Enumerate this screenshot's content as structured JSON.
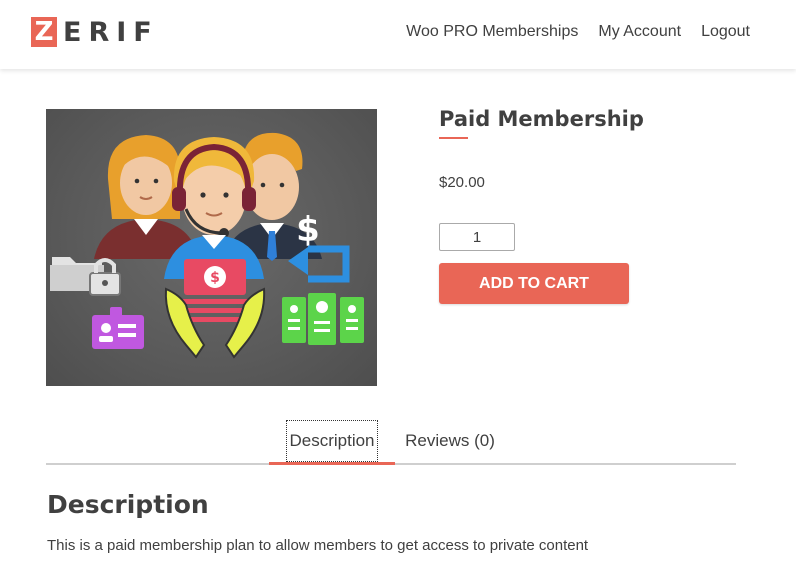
{
  "header": {
    "logo": {
      "letter": "Z",
      "rest": "ERIF"
    },
    "nav": [
      {
        "label": "Woo PRO Memberships"
      },
      {
        "label": "My Account"
      },
      {
        "label": "Logout"
      }
    ]
  },
  "product": {
    "title": "Paid Membership",
    "price": "$20.00",
    "quantity": "1",
    "add_to_cart_label": "ADD TO CART",
    "image_icon": "membership-illustration-icon"
  },
  "tabs": [
    {
      "label": "Description",
      "active": true
    },
    {
      "label": "Reviews (0)",
      "active": false
    }
  ],
  "description": {
    "heading": "Description",
    "text": "This is a paid membership plan to allow members to get access to private content"
  },
  "colors": {
    "accent": "#e96656",
    "text": "#404040",
    "image_background": "#5f5f5f"
  }
}
